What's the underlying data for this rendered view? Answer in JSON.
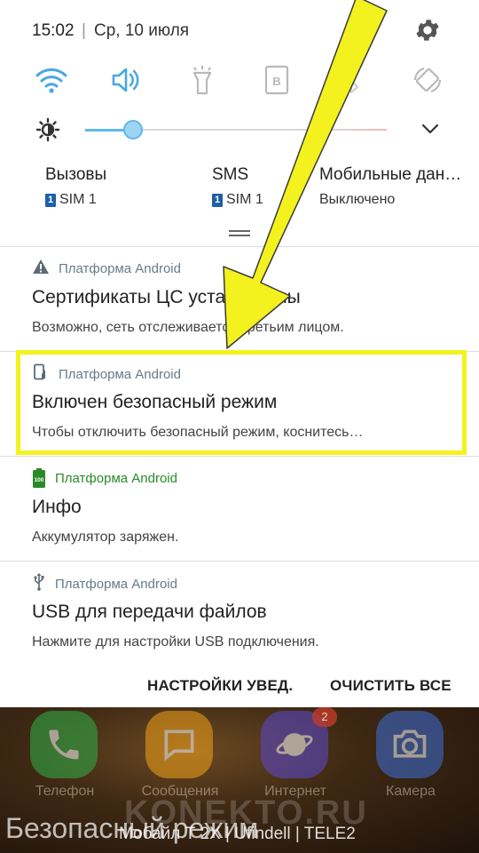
{
  "status": {
    "time": "15:02",
    "separator": "|",
    "date": "Ср, 10 июля"
  },
  "quick_settings": [
    {
      "name": "wifi",
      "icon": "wifi-icon",
      "active": true
    },
    {
      "name": "sound",
      "icon": "volume-icon",
      "active": true
    },
    {
      "name": "flashlight",
      "icon": "flashlight-icon",
      "active": false
    },
    {
      "name": "b",
      "icon": "b-mode-icon",
      "active": false,
      "glyph": "B"
    },
    {
      "name": "bluetooth",
      "icon": "bluetooth-icon",
      "active": false
    },
    {
      "name": "rotate",
      "icon": "auto-rotate-icon",
      "active": false
    }
  ],
  "brightness": {
    "level": 0.16
  },
  "sim_cards": [
    {
      "title": "Вызовы",
      "chip": "1",
      "sub": "SIM 1"
    },
    {
      "title": "SMS",
      "chip": "1",
      "sub": "SIM 1"
    },
    {
      "title": "Мобильные дан…",
      "sub": "Выключено"
    }
  ],
  "notifications": [
    {
      "icon": "warning-icon",
      "app": "Платформа Android",
      "title": "Сертификаты ЦС установлены",
      "text": "Возможно, сеть отслеживается третьим лицом."
    },
    {
      "icon": "safe-mode-icon",
      "app": "Платформа Android",
      "title": "Включен безопасный режим",
      "text": "Чтобы отключить безопасный режим, коснитесь…"
    },
    {
      "icon": "battery-icon",
      "app": "Платформа Android",
      "app_color": "#2a8a2a",
      "title": "Инфо",
      "text": "Аккумулятор заряжен.",
      "battery_label": "100"
    },
    {
      "icon": "usb-icon",
      "app": "Платформа Android",
      "title": "USB для передачи файлов",
      "text": "Нажмите для настройки USB подключения."
    }
  ],
  "actions": {
    "settings": "НАСТРОЙКИ УВЕД.",
    "clear": "ОЧИСТИТЬ ВСЕ"
  },
  "home": {
    "apps": [
      {
        "label": "Телефон",
        "icon": "phone-icon",
        "color": "#2fb24a"
      },
      {
        "label": "Сообщения",
        "icon": "messages-icon",
        "color": "#f2a21a"
      },
      {
        "label": "Интернет",
        "icon": "internet-icon",
        "color": "#5b4ad0",
        "badge": "2"
      },
      {
        "label": "Камера",
        "icon": "camera-icon",
        "color": "#3d6fd8"
      }
    ],
    "caption": "Безопасный режим",
    "watermark": "KONEKTO.RU",
    "carrier": "Мобайл Т 2X | Ufindell | TELE2"
  },
  "colors": {
    "accent": "#5fb8ea",
    "highlight": "#f4f21e",
    "app_label": "#677b8a"
  }
}
